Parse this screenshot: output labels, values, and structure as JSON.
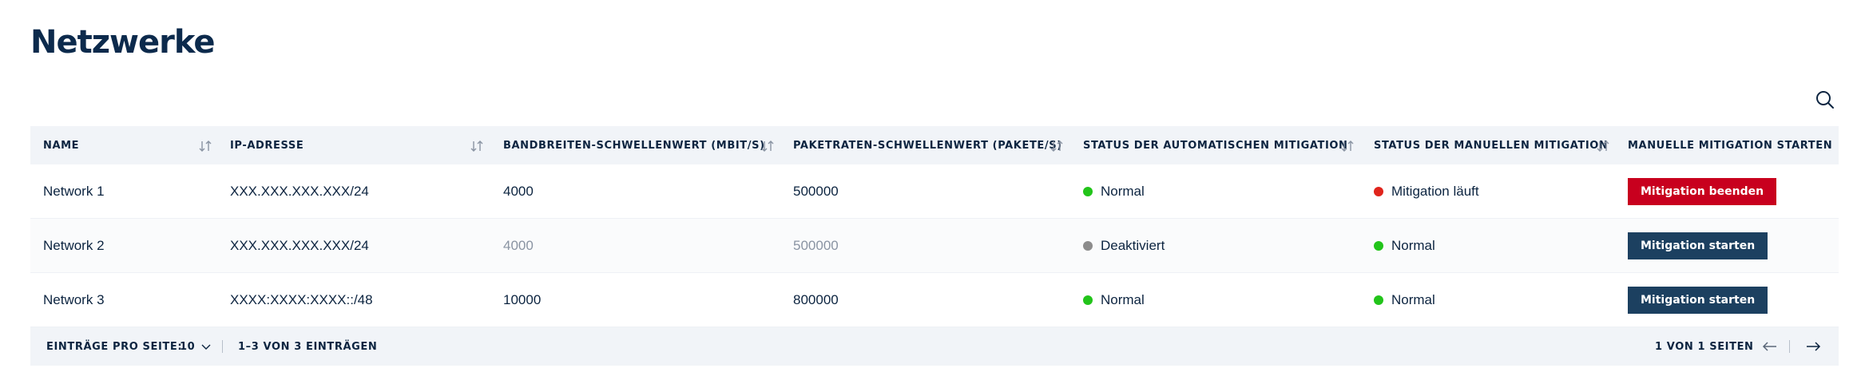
{
  "page": {
    "title": "Netzwerke"
  },
  "table": {
    "columns": [
      {
        "label": "NAME",
        "sortable": true
      },
      {
        "label": "IP-ADRESSE",
        "sortable": true
      },
      {
        "label": "BANDBREITEN-SCHWELLENWERT (MBIT/S)",
        "sortable": true
      },
      {
        "label": "PAKETRATEN-SCHWELLENWERT (PAKETE/S)",
        "sortable": true
      },
      {
        "label": "STATUS DER AUTOMATISCHEN MITIGATION",
        "sortable": true
      },
      {
        "label": "STATUS DER MANUELLEN MITIGATION",
        "sortable": true
      },
      {
        "label": "MANUELLE MITIGATION STARTEN",
        "sortable": false
      }
    ],
    "rows": [
      {
        "name": "Network 1",
        "ip": "XXX.XXX.XXX.XXX/24",
        "bandwidth": "4000",
        "packet_rate": "500000",
        "auto_status": "Normal",
        "auto_status_color": "#22c41a",
        "manual_status": "Mitigation läuft",
        "manual_status_color": "#e0241c",
        "action_label": "Mitigation beenden",
        "action_color": "#c8001e",
        "muted": false
      },
      {
        "name": "Network 2",
        "ip": "XXX.XXX.XXX.XXX/24",
        "bandwidth": "4000",
        "packet_rate": "500000",
        "auto_status": "Deaktiviert",
        "auto_status_color": "#8c8c8c",
        "manual_status": "Normal",
        "manual_status_color": "#22c41a",
        "action_label": "Mitigation starten",
        "action_color": "#1c4060",
        "muted": true
      },
      {
        "name": "Network 3",
        "ip": "XXXX:XXXX:XXXX::/48",
        "bandwidth": "10000",
        "packet_rate": "800000",
        "auto_status": "Normal",
        "auto_status_color": "#22c41a",
        "manual_status": "Normal",
        "manual_status_color": "#22c41a",
        "action_label": "Mitigation starten",
        "action_color": "#1c4060",
        "muted": false
      }
    ]
  },
  "pagination": {
    "per_page_label": "EINTRÄGE PRO SEITE:",
    "per_page_value": "10",
    "range_text": "1–3 VON 3 EINTRÄGEN",
    "page_text": "1 VON 1 SEITEN"
  },
  "icons": {
    "search": "search-icon",
    "sort": "sort-icon",
    "dropdown": "chevron-down-icon",
    "prev": "arrow-left-icon",
    "next": "arrow-right-icon"
  }
}
